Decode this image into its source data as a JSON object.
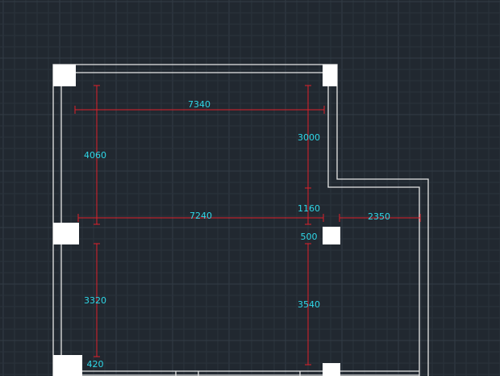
{
  "colors": {
    "background": "#212830",
    "grid_minor": "#2b333c",
    "grid_major": "#333c46",
    "wall": "#e6e6e6",
    "column": "#ffffff",
    "dimension_line": "#e0202a",
    "dimension_text": "#2fd8e8"
  },
  "dimensions": {
    "top_width": "7340",
    "left_upper_height": "4060",
    "right_upper_height": "3000",
    "right_mid_height": "1160",
    "middle_width": "7240",
    "right_offset_width": "2350",
    "column_gap": "500",
    "left_lower_height": "3320",
    "right_lower_height": "3540",
    "bottom_gap": "420"
  }
}
